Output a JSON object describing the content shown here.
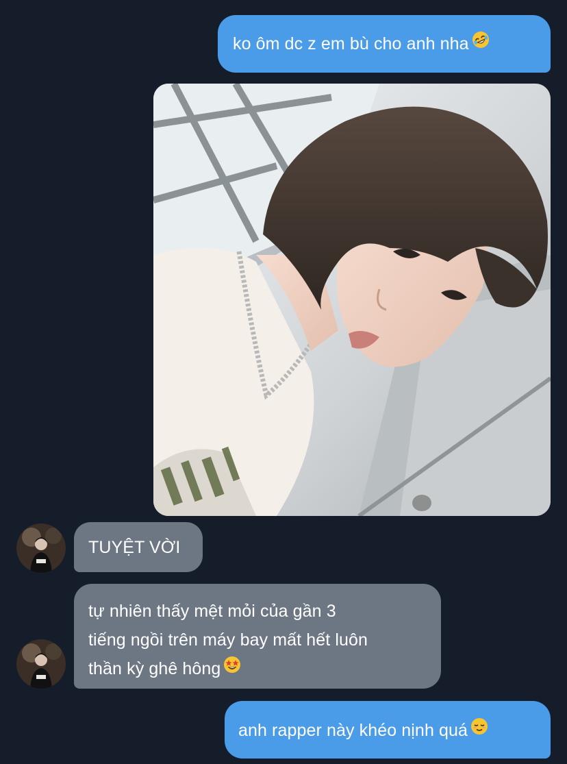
{
  "messages": {
    "outgoing_1": "ko ôm dc z em bù cho anh nha",
    "outgoing_1_emoji": "rolling-on-floor-laughing-emoji",
    "incoming_1": "TUYỆT VỜI",
    "incoming_2_line1": "tự nhiên thấy mệt mỏi của gần 3",
    "incoming_2_line2": "tiếng ngồi trên máy bay mất hết luôn",
    "incoming_2_line3": "thần kỳ ghê hông",
    "incoming_2_emoji": "star-struck-emoji",
    "outgoing_2": "anh rapper này khéo nịnh quá",
    "outgoing_2_emoji": "relieved-face-emoji"
  },
  "colors": {
    "background": "#151d2a",
    "outgoing_bubble": "#4a9be8",
    "incoming_bubble": "#6d7784",
    "text": "#ffffff"
  }
}
